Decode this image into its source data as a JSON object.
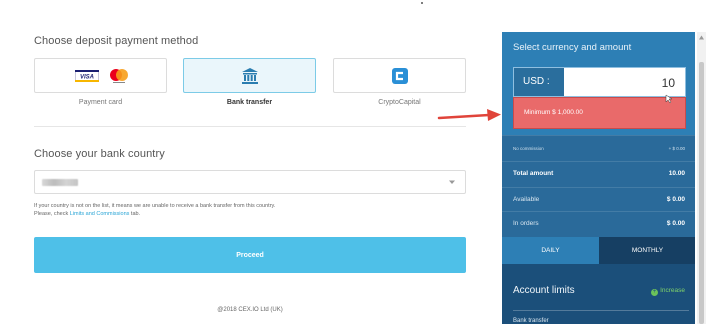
{
  "deposit": {
    "title": "Choose deposit payment method",
    "methods": [
      {
        "label": "Payment card",
        "icon": "visa-mastercard-icon",
        "selected": false
      },
      {
        "label": "Bank transfer",
        "icon": "bank-icon",
        "selected": true
      },
      {
        "label": "CryptoCapital",
        "icon": "cryptocapital-icon",
        "selected": false
      }
    ],
    "visa_text": "VISA"
  },
  "country": {
    "title": "Choose your bank country",
    "selected_value": "",
    "note_text": "If your country is not on the list, it means we are unable to receive a bank transfer from this country.",
    "note_prefix": "Please, check",
    "note_link": "Limits and Commissions",
    "note_suffix": "tab."
  },
  "proceed_label": "Proceed",
  "footer": "@2018 CEX.IO Ltd (UK)",
  "side_panel": {
    "title": "Select currency and amount",
    "currency": "USD",
    "amount": "10",
    "minimum_warning": "Minimum $ 1,000.00",
    "rows": [
      {
        "label": "No commission",
        "value": "+ $ 0.00"
      },
      {
        "label": "Total amount",
        "value": "10.00"
      },
      {
        "label": "Available",
        "value": "$ 0.00"
      },
      {
        "label": "In orders",
        "value": "$ 0.00"
      }
    ],
    "tabs": [
      "DAILY",
      "MONTHLY"
    ],
    "active_tab": "MONTHLY",
    "limits_title": "Account limits",
    "increase_label": "Increase",
    "limits_row": "Bank transfer"
  },
  "colors": {
    "accent": "#4ec0e8",
    "panel_dark": "#1b4f7a",
    "panel_mid": "#2d7fb5",
    "warning": "#e96a6a",
    "arrow": "#e0443a",
    "increase": "#7fd36a"
  }
}
